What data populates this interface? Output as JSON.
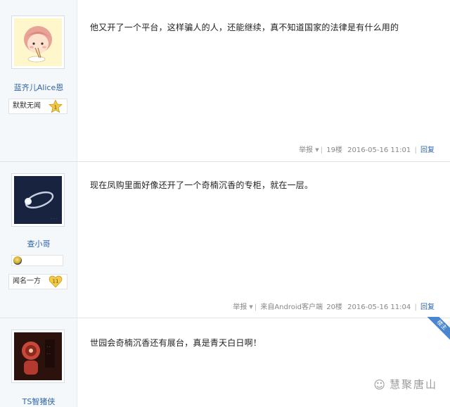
{
  "posts": [
    {
      "username": "蓝齐儿Alice恩",
      "rank": "默默无闻",
      "level": "1",
      "content": "他又开了一个平台，这样骗人的人，还能继续，真不知道国家的法律是有什么用的",
      "report": "举报",
      "source": "",
      "floor": "19楼",
      "time": "2016-05-16 11:01",
      "reply": "回复"
    },
    {
      "username": "查小哥",
      "rank": "闻名一方",
      "level": "11",
      "content": "现在凤购里面好像还开了一个奇楠沉香的专柜，就在一层。",
      "report": "举报",
      "source": "来自Android客户端",
      "floor": "20楼",
      "time": "2016-05-16 11:04",
      "reply": "回复"
    },
    {
      "username": "TS智猪侠",
      "ribbon": "楼主",
      "content": "世园会奇楠沉香还有展台，真是青天白日啊！"
    }
  ],
  "watermark": "慧聚唐山",
  "icons": {
    "report_caret": "caret-down-icon",
    "level_badge": "star-badge-icon",
    "level_badge_heart": "heart-badge-icon",
    "medal": "medal-icon",
    "watermark": "wechat-icon"
  }
}
